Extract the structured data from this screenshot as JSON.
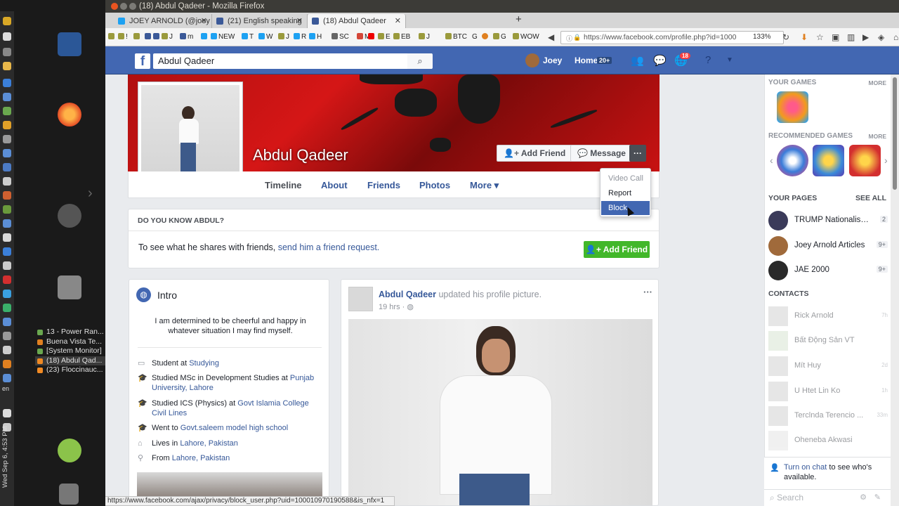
{
  "window": {
    "title": "(18) Abdul Qadeer - Mozilla Firefox"
  },
  "tabs": [
    {
      "label": "JOEY ARNOLD (@joey"
    },
    {
      "label": "(21) English speaking"
    },
    {
      "label": "(18) Abdul Qadeer"
    }
  ],
  "bookmarks": [
    "!",
    "J",
    "m",
    "NEW",
    "T",
    "W",
    "J",
    "R",
    "H",
    "SC",
    "M",
    "E",
    "EB",
    "J",
    "BTC",
    "G",
    "G",
    "WOW"
  ],
  "url": {
    "value": "https://www.facebook.com/profile.php?id=1000",
    "zoom": "133%"
  },
  "fb_header": {
    "search_value": "Abdul Qadeer",
    "user_name": "Joey",
    "home_label": "Home",
    "home_badge": "20+",
    "notification_count": "18"
  },
  "profile": {
    "name": "Abdul Qadeer",
    "add_friend_label": "Add Friend",
    "message_label": "Message",
    "more_dots": "···",
    "tabs": [
      "Timeline",
      "About",
      "Friends",
      "Photos",
      "More ▾"
    ]
  },
  "dropdown": {
    "items": [
      "Video Call",
      "Report",
      "Block"
    ]
  },
  "know": {
    "title": "DO YOU KNOW ABDUL?",
    "text": "To see what he shares with friends,",
    "link": "send him a friend request.",
    "button": "Add Friend"
  },
  "intro": {
    "title": "Intro",
    "bio": "I am determined to be cheerful and happy in whatever situation I may find myself.",
    "rows": [
      {
        "prefix": "Student at ",
        "link": "Studying",
        "suffix": ""
      },
      {
        "prefix": "Studied MSc in Development Studies at ",
        "link": "Punjab University, Lahore",
        "suffix": ""
      },
      {
        "prefix": "Studied ICS (Physics) at ",
        "link": "Govt Islamia College Civil Lines",
        "suffix": ""
      },
      {
        "prefix": "Went to ",
        "link": "Govt.saleem model high school",
        "suffix": ""
      },
      {
        "prefix": "Lives in ",
        "link": "Lahore, Pakistan",
        "suffix": ""
      },
      {
        "prefix": "From ",
        "link": "Lahore, Pakistan",
        "suffix": ""
      }
    ]
  },
  "post": {
    "author": "Abdul Qadeer",
    "action": "updated his profile picture.",
    "time": "19 hrs",
    "menu": "···"
  },
  "right_sidebar": {
    "your_games": "YOUR GAMES",
    "more1": "MORE",
    "recommended_games": "RECOMMENDED GAMES",
    "more2": "MORE",
    "your_pages": "YOUR PAGES",
    "see_all": "SEE ALL",
    "pages": [
      {
        "name": "TRUMP Nationalism ...",
        "count": "2"
      },
      {
        "name": "Joey Arnold Articles",
        "count": "9+"
      },
      {
        "name": "JAE 2000",
        "count": "9+"
      }
    ],
    "contacts_title": "CONTACTS",
    "contacts": [
      {
        "name": "Rick Arnold",
        "time": "7h"
      },
      {
        "name": "Bất Động Sản VT",
        "time": ""
      },
      {
        "name": "Mít Huy",
        "time": "2d"
      },
      {
        "name": "U Htet Lin Ko",
        "time": "1h"
      },
      {
        "name": "Terclnda Terencio ...",
        "time": "33m"
      },
      {
        "name": "Oheneba Akwasi",
        "time": ""
      }
    ],
    "chat_link": "Turn on chat",
    "chat_text": " to see who's available.",
    "chat_search": "Search"
  },
  "taskbar": [
    "13 - Power Ran...",
    "Buena Vista Te...",
    "[System Monitor]",
    "(18) Abdul Qad...",
    "(23) Floccinauc..."
  ],
  "system": {
    "clock": "Wed Sep 6, 4:53 PM",
    "lang": "en"
  },
  "status_bar": "https://www.facebook.com/ajax/privacy/block_user.php?uid=100010970190588&is_nfx=1"
}
